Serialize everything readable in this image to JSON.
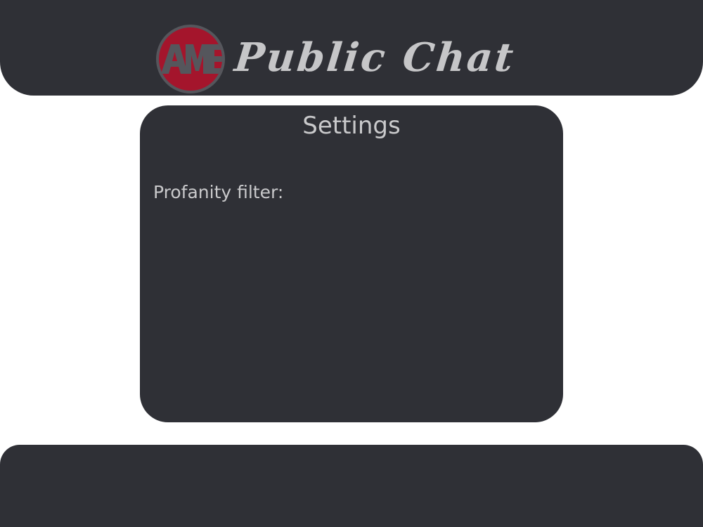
{
  "header": {
    "logo_text": "AME",
    "app_title": "Public Chat"
  },
  "settings": {
    "title": "Settings",
    "profanity_filter_label": "Profanity filter:"
  },
  "colors": {
    "panel_bg": "#2f3036",
    "page_bg": "#ffffff",
    "text": "#c9c9cb",
    "logo_red": "#a4152c",
    "logo_ring": "#55565c"
  }
}
